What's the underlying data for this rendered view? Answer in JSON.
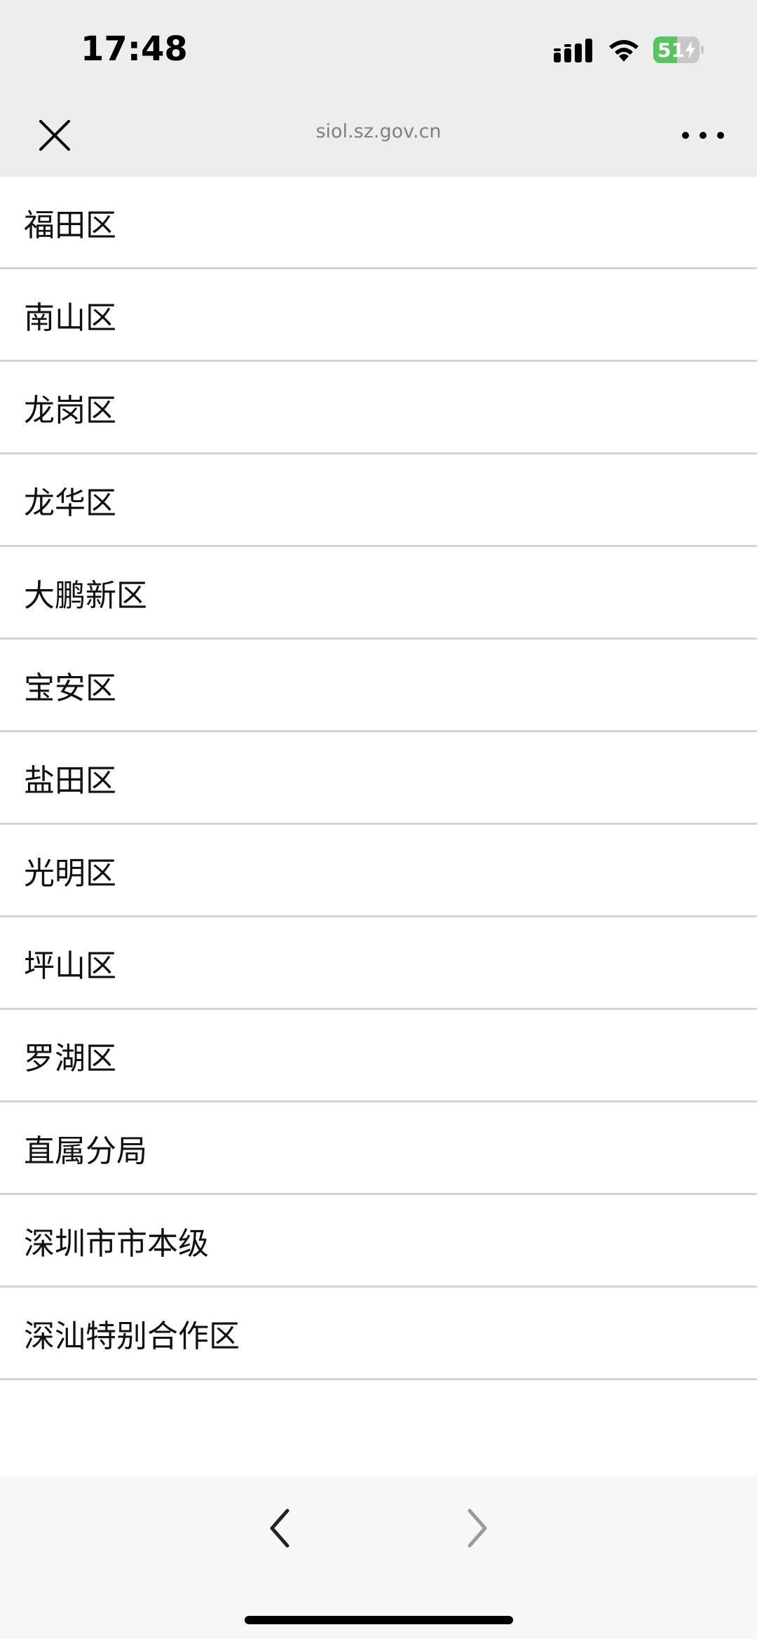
{
  "status_bar": {
    "time": "17:48",
    "battery_level": "51",
    "battery_fraction": 0.51,
    "signal_icon": "cellular-signal-icon",
    "wifi_icon": "wifi-icon",
    "battery_icon": "battery-charging-icon",
    "battery_color": "#5ac35e"
  },
  "nav": {
    "url": "siol.sz.gov.cn",
    "close_icon": "close-icon",
    "more_icon": "more-icon"
  },
  "list": {
    "items": [
      "福田区",
      "南山区",
      "龙岗区",
      "龙华区",
      "大鹏新区",
      "宝安区",
      "盐田区",
      "光明区",
      "坪山区",
      "罗湖区",
      "直属分局",
      "深圳市市本级",
      "深汕特别合作区"
    ]
  },
  "toolbar": {
    "back_icon": "chevron-left-icon",
    "forward_icon": "chevron-right-icon"
  }
}
